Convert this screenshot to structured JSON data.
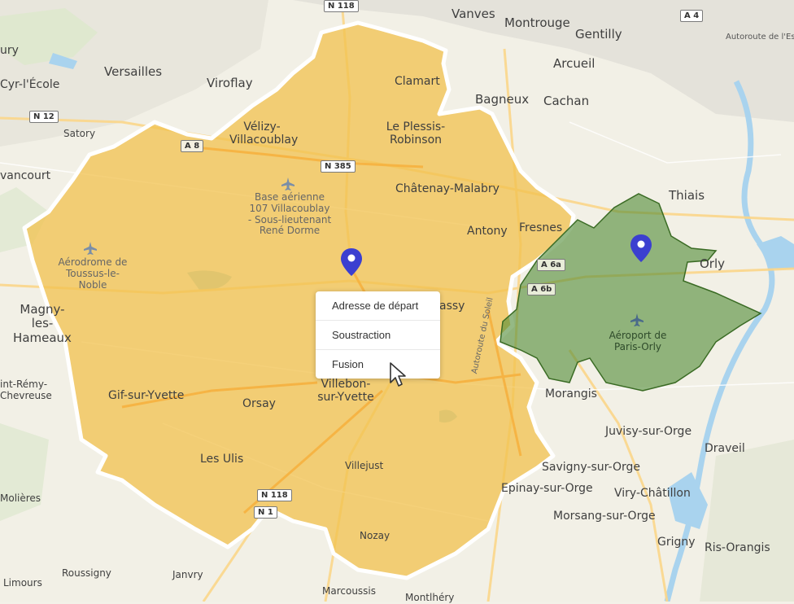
{
  "map": {
    "places": [
      {
        "id": "vanves",
        "text": "Vanves"
      },
      {
        "id": "montrouge",
        "text": "Montrouge"
      },
      {
        "id": "gentilly",
        "text": "Gentilly"
      },
      {
        "id": "versailles",
        "text": "Versailles"
      },
      {
        "id": "viroflay",
        "text": "Viroflay"
      },
      {
        "id": "clamart",
        "text": "Clamart"
      },
      {
        "id": "arcueil",
        "text": "Arcueil"
      },
      {
        "id": "bagneux",
        "text": "Bagneux"
      },
      {
        "id": "cachan",
        "text": "Cachan"
      },
      {
        "id": "satory",
        "text": "Satory"
      },
      {
        "id": "velizy",
        "text": "Vélizy-\nVillacoublay"
      },
      {
        "id": "plessis",
        "text": "Le Plessis-\nRobinson"
      },
      {
        "id": "vancourt",
        "text": "vancourt"
      },
      {
        "id": "chatenay",
        "text": "Châtenay-Malabry"
      },
      {
        "id": "thiais",
        "text": "Thiais"
      },
      {
        "id": "antony",
        "text": "Antony"
      },
      {
        "id": "fresnes",
        "text": "Fresnes"
      },
      {
        "id": "orly",
        "text": "Orly"
      },
      {
        "id": "magny",
        "text": "Magny-les-\nHameaux"
      },
      {
        "id": "massy",
        "text": "assy"
      },
      {
        "id": "villebon",
        "text": "Villebon-\nsur-Yvette"
      },
      {
        "id": "gif",
        "text": "Gif-sur-Yvette"
      },
      {
        "id": "orsay",
        "text": "Orsay"
      },
      {
        "id": "morangis",
        "text": "Morangis"
      },
      {
        "id": "juvisy",
        "text": "Juvisy-sur-Orge"
      },
      {
        "id": "draveil",
        "text": "Draveil"
      },
      {
        "id": "lesulis",
        "text": "Les Ulis"
      },
      {
        "id": "savigny",
        "text": "Savigny-sur-Orge"
      },
      {
        "id": "epinay",
        "text": "Epinay-sur-Orge"
      },
      {
        "id": "viry",
        "text": "Viry-Châtillon"
      },
      {
        "id": "morsang",
        "text": "Morsang-sur-Orge"
      },
      {
        "id": "grigny",
        "text": "Grigny"
      },
      {
        "id": "risorangis",
        "text": "Ris-Orangis"
      },
      {
        "id": "roussigny",
        "text": "Roussigny"
      },
      {
        "id": "janvry",
        "text": "Janvry"
      },
      {
        "id": "limours",
        "text": "Limours"
      },
      {
        "id": "marcoussis",
        "text": "Marcoussis"
      },
      {
        "id": "montlhery",
        "text": "Montlhéry"
      },
      {
        "id": "nozay",
        "text": "Nozay"
      },
      {
        "id": "villejust",
        "text": "Villejust"
      },
      {
        "id": "molieres",
        "text": "Molières"
      },
      {
        "id": "stremy",
        "text": "int-Rémy-\nChevreuse"
      },
      {
        "id": "cyr",
        "text": "Cyr-l'École"
      },
      {
        "id": "jury",
        "text": "ury"
      }
    ],
    "pois": [
      {
        "id": "base",
        "text": "Base aérienne\n107 Villacoublay\n- Sous-lieutenant\nRené Dorme"
      },
      {
        "id": "toussus",
        "text": "Aérodrome de\nToussus-le-Noble"
      },
      {
        "id": "orly-airport",
        "text": "Aéroport de\nParis-Orly"
      }
    ],
    "roads": [
      {
        "id": "n118-top",
        "text": "N 118"
      },
      {
        "id": "a4",
        "text": "A 4"
      },
      {
        "id": "autoroute-est",
        "text": "Autoroute de l'Es"
      },
      {
        "id": "n12",
        "text": "N 12"
      },
      {
        "id": "a86",
        "text": "A 8"
      },
      {
        "id": "n385",
        "text": "N 385"
      },
      {
        "id": "a6a",
        "text": "A 6a"
      },
      {
        "id": "a6b",
        "text": "A 6b"
      },
      {
        "id": "n118-bottom",
        "text": "N 118"
      },
      {
        "id": "n104",
        "text": "N 1"
      },
      {
        "id": "autoroute-soleil",
        "text": "Autoroute du Soleil"
      }
    ],
    "colors": {
      "zone_orange": "#f2c24e",
      "zone_green": "#4f8a34",
      "pin": "#3b3fd0"
    }
  },
  "context_menu": {
    "items": [
      {
        "label": "Adresse de départ"
      },
      {
        "label": "Soustraction"
      },
      {
        "label": "Fusion"
      }
    ]
  }
}
